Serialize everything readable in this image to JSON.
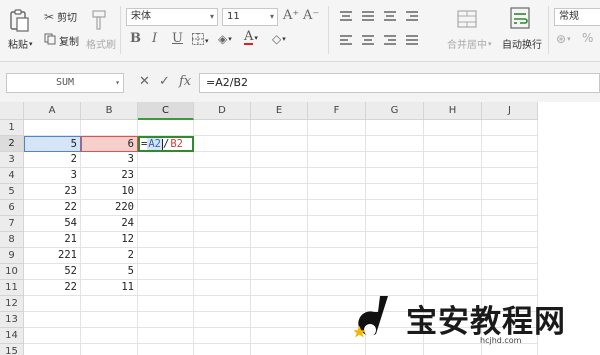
{
  "ribbon": {
    "paste_label": "粘贴",
    "cut_label": "剪切",
    "copy_label": "复制",
    "format_painter_label": "格式刷",
    "font_name": "宋体",
    "font_size": "11",
    "merge_center_label": "合并居中",
    "wrap_text_label": "自动换行",
    "number_format": "常规",
    "bold_label": "B",
    "italic_label": "I",
    "underline_label": "U",
    "font_color_label": "A",
    "grow_font_label": "A⁺",
    "shrink_font_label": "A⁻"
  },
  "formula_bar": {
    "name_box": "SUM",
    "cancel_icon": "✕",
    "enter_icon": "✓",
    "fx_label": "fx",
    "formula": "=A2/B2"
  },
  "sheet": {
    "columns": [
      "A",
      "B",
      "C",
      "D",
      "E",
      "F",
      "G",
      "H",
      "J"
    ],
    "active_column": "C",
    "active_row": 2,
    "rows": [
      {
        "num": "1",
        "a": "",
        "b": ""
      },
      {
        "num": "2",
        "a": "5",
        "b": "6"
      },
      {
        "num": "3",
        "a": "2",
        "b": "3"
      },
      {
        "num": "4",
        "a": "3",
        "b": "23"
      },
      {
        "num": "5",
        "a": "23",
        "b": "10"
      },
      {
        "num": "6",
        "a": "22",
        "b": "220"
      },
      {
        "num": "7",
        "a": "54",
        "b": "24"
      },
      {
        "num": "8",
        "a": "21",
        "b": "12"
      },
      {
        "num": "9",
        "a": "221",
        "b": "2"
      },
      {
        "num": "10",
        "a": "52",
        "b": "5"
      },
      {
        "num": "11",
        "a": "22",
        "b": "11"
      },
      {
        "num": "12",
        "a": "",
        "b": ""
      },
      {
        "num": "13",
        "a": "",
        "b": ""
      },
      {
        "num": "14",
        "a": "",
        "b": ""
      },
      {
        "num": "15",
        "a": "",
        "b": ""
      }
    ],
    "edit_cell": {
      "prefix": "=",
      "ref1": "A2",
      "operator": "/",
      "ref2": "B2"
    }
  },
  "watermark": {
    "title": "宝安教程网",
    "url": "hcjhd.com"
  },
  "colors": {
    "accent_green": "#2e8b2e",
    "ref_blue": "#4a86d8",
    "ref_red": "#d9534f"
  }
}
